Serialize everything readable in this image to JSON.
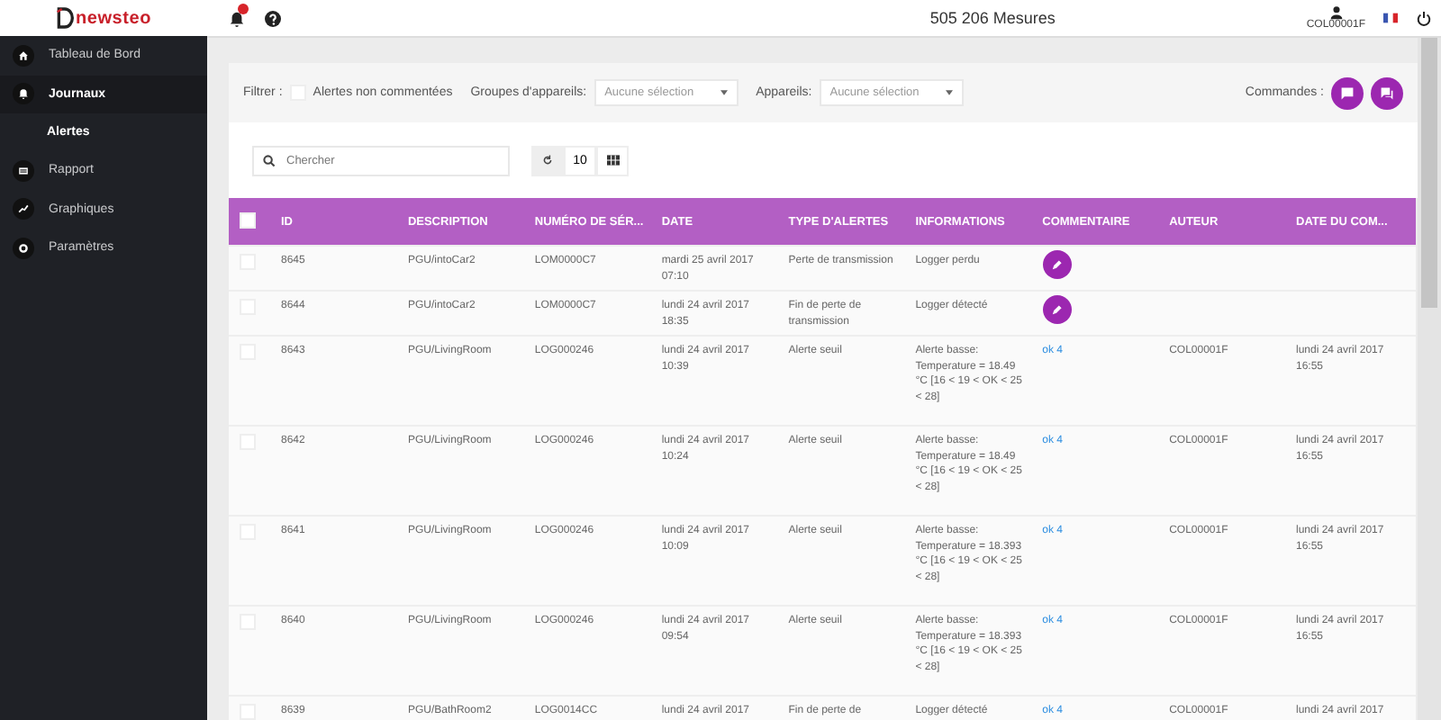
{
  "logo": {
    "name": "newsteo"
  },
  "sidebar": {
    "items": [
      {
        "label": "Tableau de Bord",
        "selected": false
      },
      {
        "label": "Journaux",
        "selected": true,
        "children": [
          {
            "label": "Alertes",
            "selected": true
          }
        ]
      },
      {
        "label": "Rapport",
        "selected": false
      },
      {
        "label": "Graphiques",
        "selected": false
      },
      {
        "label": "Paramètres",
        "selected": false
      }
    ]
  },
  "header": {
    "measures": "505 206 Mesures",
    "user": "COL00001F"
  },
  "filter": {
    "label": "Filtrer :",
    "unanswered": {
      "label": "Alertes non commentées",
      "checked": false
    },
    "selects": [
      {
        "label": "Groupes d'appareils:",
        "placeholder": "Aucune sélection"
      },
      {
        "label": "Appareils:",
        "placeholder": "Aucune sélection"
      }
    ],
    "commands_label": "Commandes :"
  },
  "toolbar": {
    "search_placeholder": "Chercher",
    "page_size": "10"
  },
  "table": {
    "all_checked": false,
    "columns": [
      "ID",
      "DESCRIPTION",
      "NUMÉRO DE SÉR...",
      "DATE",
      "TYPE D'ALERTES",
      "INFORMATIONS",
      "COMMENTAIRE",
      "AUTEUR",
      "DATE DU COM..."
    ],
    "rows": [
      {
        "checked": false,
        "id": "8645",
        "description": "PGU/intoCar2",
        "serial": "LOM0000C7",
        "date": "mardi 25 avril 2017 07:10",
        "type": "Perte de transmission",
        "info": "Logger perdu",
        "comment": {
          "kind": "button"
        }
      },
      {
        "checked": false,
        "id": "8644",
        "description": "PGU/intoCar2",
        "serial": "LOM0000C7",
        "date": "lundi 24 avril 2017 18:35",
        "type": "Fin de perte de transmission",
        "info": "Logger détecté",
        "comment": {
          "kind": "button"
        }
      },
      {
        "checked": false,
        "id": "8643",
        "description": "PGU/LivingRoom",
        "serial": "LOG000246",
        "date": "lundi 24 avril 2017 10:39",
        "type": "Alerte seuil",
        "info": "Alerte basse: Temperature = 18.49 °C [16 < 19 < OK < 25 < 28]",
        "comment": {
          "kind": "link",
          "text": "ok 4"
        },
        "author": "COL00001F",
        "comment_date": "lundi 24 avril 2017 16:55"
      },
      {
        "checked": false,
        "id": "8642",
        "description": "PGU/LivingRoom",
        "serial": "LOG000246",
        "date": "lundi 24 avril 2017 10:24",
        "type": "Alerte seuil",
        "info": "Alerte basse: Temperature = 18.49 °C [16 < 19 < OK < 25 < 28]",
        "comment": {
          "kind": "link",
          "text": "ok 4"
        },
        "author": "COL00001F",
        "comment_date": "lundi 24 avril 2017 16:55"
      },
      {
        "checked": false,
        "id": "8641",
        "description": "PGU/LivingRoom",
        "serial": "LOG000246",
        "date": "lundi 24 avril 2017 10:09",
        "type": "Alerte seuil",
        "info": "Alerte basse: Temperature = 18.393 °C [16 < 19 < OK < 25 < 28]",
        "comment": {
          "kind": "link",
          "text": "ok 4"
        },
        "author": "COL00001F",
        "comment_date": "lundi 24 avril 2017 16:55"
      },
      {
        "checked": false,
        "id": "8640",
        "description": "PGU/LivingRoom",
        "serial": "LOG000246",
        "date": "lundi 24 avril 2017 09:54",
        "type": "Alerte seuil",
        "info": "Alerte basse: Temperature = 18.393 °C [16 < 19 < OK < 25 < 28]",
        "comment": {
          "kind": "link",
          "text": "ok 4"
        },
        "author": "COL00001F",
        "comment_date": "lundi 24 avril 2017 16:55"
      },
      {
        "checked": false,
        "id": "8639",
        "description": "PGU/BathRoom2",
        "serial": "LOG0014CC",
        "date": "lundi 24 avril 2017",
        "type": "Fin de perte de",
        "info": "Logger détecté",
        "comment": {
          "kind": "link",
          "text": "ok 4"
        },
        "author": "COL00001F",
        "comment_date": "lundi 24 avril 2017"
      }
    ]
  }
}
